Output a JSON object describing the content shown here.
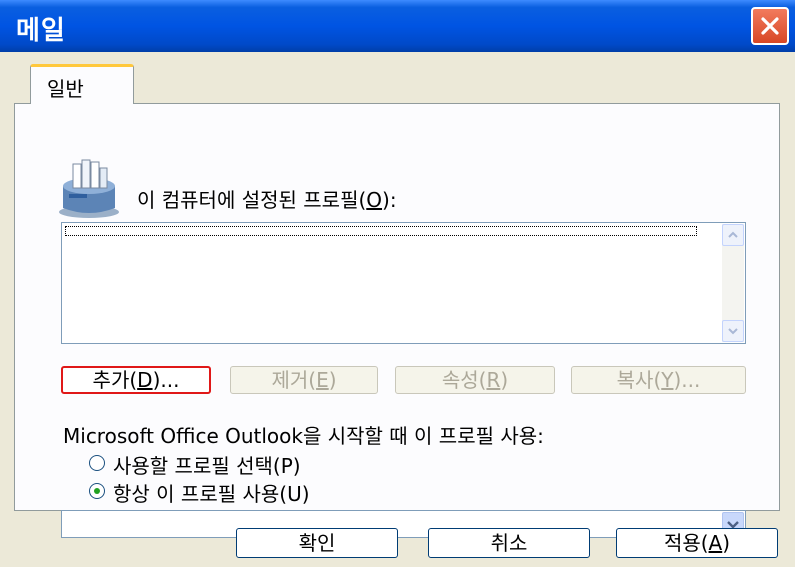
{
  "window": {
    "title": "메일",
    "close_label": "×"
  },
  "tabs": [
    {
      "label": "일반",
      "active": true
    }
  ],
  "profiles": {
    "label_prefix": "이 컴퓨터에 설정된 프로필(",
    "label_hotkey": "O",
    "label_suffix": "):",
    "items": []
  },
  "profile_buttons": [
    {
      "prefix": "추가(",
      "hotkey": "D",
      "suffix": ")...",
      "enabled": true,
      "focused": true
    },
    {
      "prefix": "제거(",
      "hotkey": "E",
      "suffix": ")",
      "enabled": false
    },
    {
      "prefix": "속성(",
      "hotkey": "R",
      "suffix": ")",
      "enabled": false
    },
    {
      "prefix": "복사(",
      "hotkey": "Y",
      "suffix": ")...",
      "enabled": false
    }
  ],
  "startup": {
    "label": "Microsoft Office Outlook을 시작할 때 이 프로필 사용:",
    "options": [
      {
        "label": "사용할 프로필 선택(P)",
        "checked": false
      },
      {
        "label": "항상 이 프로필 사용(U)",
        "checked": true
      }
    ],
    "selected_profile": ""
  },
  "footer_buttons": {
    "ok": "확인",
    "cancel": "취소",
    "apply_prefix": "적용(",
    "apply_hotkey": "A",
    "apply_suffix": ")"
  }
}
